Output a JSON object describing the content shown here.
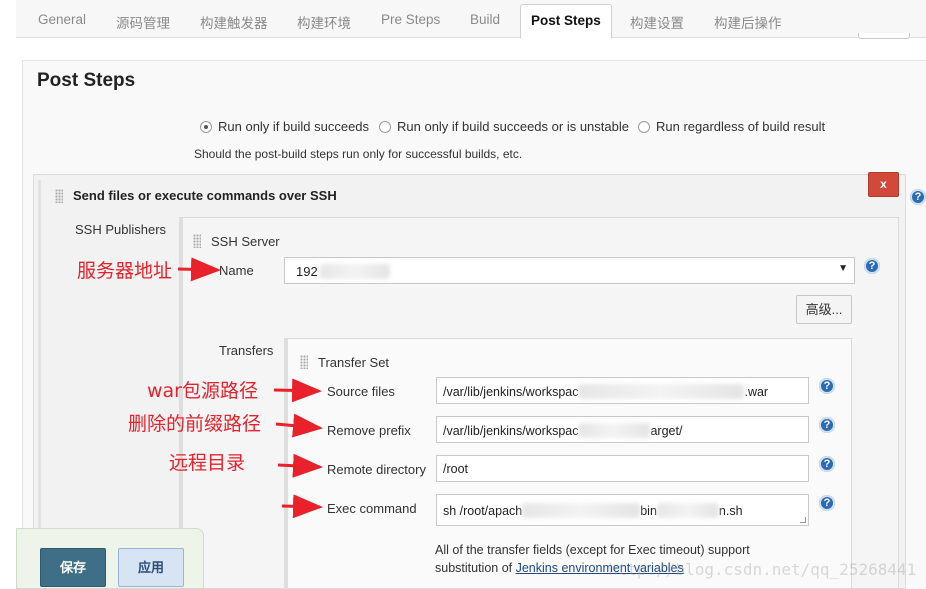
{
  "tabs": [
    {
      "label": "General"
    },
    {
      "label": "源码管理"
    },
    {
      "label": "构建触发器"
    },
    {
      "label": "构建环境"
    },
    {
      "label": "Pre Steps"
    },
    {
      "label": "Build"
    },
    {
      "label": "Post Steps"
    },
    {
      "label": "构建设置"
    },
    {
      "label": "构建后操作"
    }
  ],
  "active_tab": "Post Steps",
  "section": {
    "title": "Post Steps"
  },
  "post_steps": {
    "options": [
      {
        "label": "Run only if build succeeds",
        "checked": true
      },
      {
        "label": "Run only if build succeeds or is unstable",
        "checked": false
      },
      {
        "label": "Run regardless of build result",
        "checked": false
      }
    ],
    "help": "Should the post-build steps run only for successful builds, etc."
  },
  "builder": {
    "title": "Send files or execute commands over SSH",
    "close_label": "x",
    "publishers_label": "SSH Publishers",
    "server_label": "SSH Server",
    "name_label": "Name",
    "name_value": "192",
    "advanced_label": "高级...",
    "transfers_label": "Transfers",
    "transfer_set_label": "Transfer Set",
    "fields": {
      "source_files": {
        "label": "Source files",
        "value_prefix": "/var/lib/jenkins/workspac",
        "value_suffix": ".war"
      },
      "remove_prefix": {
        "label": "Remove prefix",
        "value_prefix": "/var/lib/jenkins/workspac",
        "value_suffix": "arget/"
      },
      "remote_directory": {
        "label": "Remote directory",
        "value": "/root"
      },
      "exec_command": {
        "label": "Exec command",
        "value_prefix": "sh /root/apach",
        "value_middle": "bin",
        "value_suffix": "n.sh"
      }
    },
    "note_line1": "All of the transfer fields (except for Exec timeout) support",
    "note_prefix": "substitution of ",
    "note_link": "Jenkins environment variables"
  },
  "help_icon_glyph": "?",
  "annotations": {
    "server_address": "服务器地址",
    "war_source": "war包源路径",
    "remove_prefix": "删除的前缀路径",
    "remote_dir": "远程目录"
  },
  "buttons": {
    "save": "保存",
    "apply": "应用"
  },
  "watermark": "http://blog.csdn.net/qq_25268441",
  "colors": {
    "close": "#d24939",
    "save": "#3e6f86",
    "apply": "#d7e4f4",
    "help": "#2d6ab4",
    "annotation": "#e8212b"
  }
}
